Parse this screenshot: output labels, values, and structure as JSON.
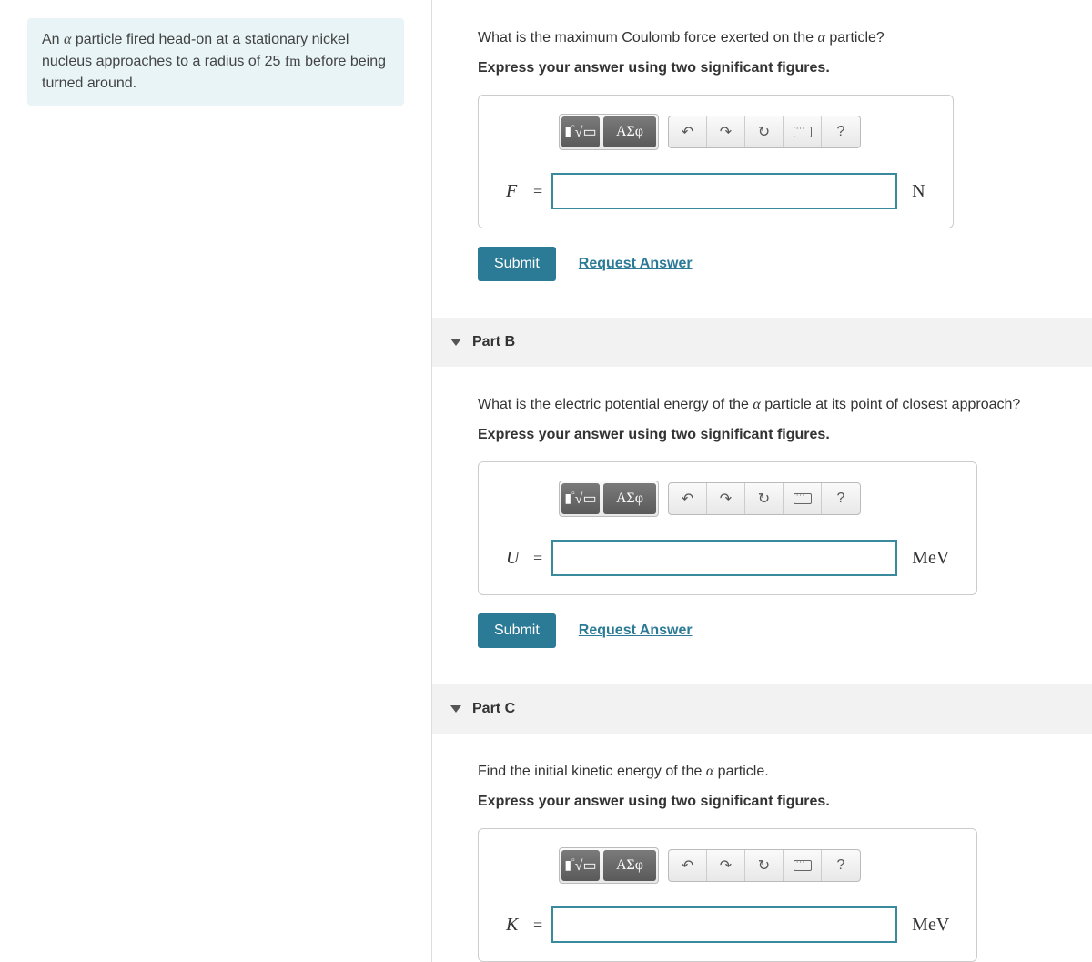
{
  "problem": {
    "text_before_alpha": "An ",
    "alpha": "α",
    "text_mid": " particle fired head-on at a stationary nickel nucleus approaches to a radius of 25 ",
    "fm": "fm",
    "text_end": " before being turned around."
  },
  "partA": {
    "question_before": "What is the maximum Coulomb force exerted on the ",
    "alpha": "α",
    "question_after": " particle?",
    "instruction": "Express your answer using two significant figures.",
    "variable": "F",
    "equals": "=",
    "unit": "N",
    "submit": "Submit",
    "request": "Request Answer"
  },
  "partB": {
    "title": "Part B",
    "question_before": "What is the electric potential energy of the ",
    "alpha": "α",
    "question_after": " particle at its point of closest approach?",
    "instruction": "Express your answer using two significant figures.",
    "variable": "U",
    "equals": "=",
    "unit": "MeV",
    "submit": "Submit",
    "request": "Request Answer"
  },
  "partC": {
    "title": "Part C",
    "question_before": "Find the initial kinetic energy of the ",
    "alpha": "α",
    "question_after": " particle.",
    "instruction": "Express your answer using two significant figures.",
    "variable": "K",
    "equals": "=",
    "unit": "MeV"
  },
  "toolbar": {
    "templates": "▮√▭",
    "greek": "ΑΣφ",
    "undo": "↶",
    "redo": "↷",
    "reset": "↻",
    "help": "?"
  }
}
